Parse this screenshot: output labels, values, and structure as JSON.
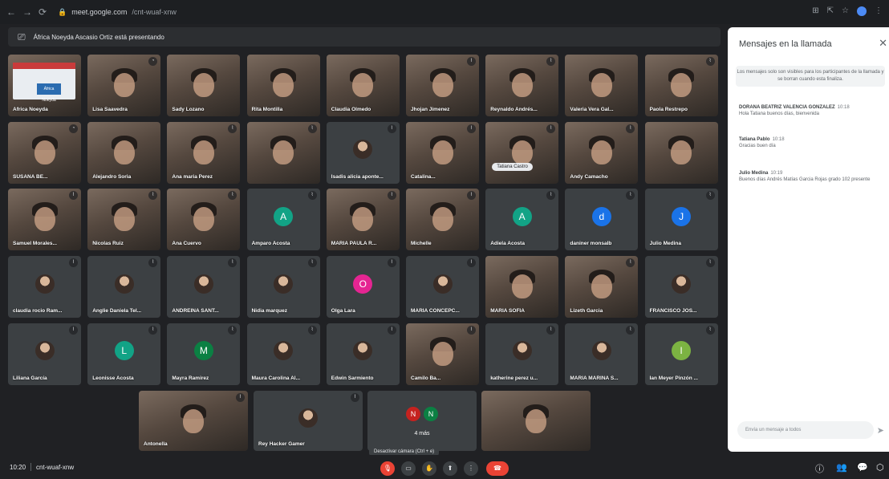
{
  "browser": {
    "url_host": "meet.google.com",
    "url_path": "/cnt-wuaf-xnw"
  },
  "presenting_banner": "África Noeyda Ascasio Ortiz está presentando",
  "tiles": [
    {
      "name": "Africa Noeyda",
      "type": "slide",
      "row": 0,
      "col": 0,
      "mic": "",
      "slide_text": "África Noeyda"
    },
    {
      "name": "Lisa Saavedra",
      "type": "video",
      "row": 0,
      "col": 1,
      "mic": "◔"
    },
    {
      "name": "Sady Lozano",
      "type": "video",
      "row": 0,
      "col": 2,
      "mic": ""
    },
    {
      "name": "Rita Montilla",
      "type": "video",
      "row": 0,
      "col": 3,
      "mic": ""
    },
    {
      "name": "Claudia Olmedo",
      "type": "video",
      "row": 0,
      "col": 4,
      "mic": ""
    },
    {
      "name": "Jhojan Jimenez",
      "type": "video",
      "row": 0,
      "col": 5,
      "mic": "⌇"
    },
    {
      "name": "Reynaldo Andrés...",
      "type": "video",
      "row": 0,
      "col": 6,
      "mic": "⌇"
    },
    {
      "name": "Valeria Vera Gal...",
      "type": "video",
      "row": 0,
      "col": 7,
      "mic": ""
    },
    {
      "name": "Paola Restrepo",
      "type": "video",
      "row": 0,
      "col": 8,
      "mic": "⌇"
    },
    {
      "name": "SUSANA BE...",
      "type": "video",
      "row": 1,
      "col": 0,
      "mic": "◔"
    },
    {
      "name": "Alejandro Soria",
      "type": "video",
      "row": 1,
      "col": 1,
      "mic": ""
    },
    {
      "name": "Ana maria Perez",
      "type": "video",
      "row": 1,
      "col": 2,
      "mic": "⌇"
    },
    {
      "name": "",
      "type": "video",
      "row": 1,
      "col": 3,
      "mic": "⌇"
    },
    {
      "name": "Isadis alicia aponte...",
      "type": "photo",
      "row": 1,
      "col": 4,
      "mic": "⌇"
    },
    {
      "name": "Catalina...",
      "type": "video",
      "row": 1,
      "col": 5,
      "mic": "⌇"
    },
    {
      "name": "",
      "type": "video",
      "row": 1,
      "col": 6,
      "mic": "⌇",
      "pill": "Tatiana Castro"
    },
    {
      "name": "Andy Camacho",
      "type": "video",
      "row": 1,
      "col": 7,
      "mic": "⌇"
    },
    {
      "name": "",
      "type": "video",
      "row": 1,
      "col": 8,
      "mic": ""
    },
    {
      "name": "Samuel Morales...",
      "type": "video",
      "row": 2,
      "col": 0,
      "mic": "⌇"
    },
    {
      "name": "Nicolas Ruiz",
      "type": "video",
      "row": 2,
      "col": 1,
      "mic": "⌇"
    },
    {
      "name": "Ana Cuervo",
      "type": "video",
      "row": 2,
      "col": 2,
      "mic": "⌇"
    },
    {
      "name": "Amparo Acosta",
      "type": "avatar",
      "row": 2,
      "col": 3,
      "mic": "⌇",
      "initial": "A",
      "color": "#12a386"
    },
    {
      "name": "MARIA PAULA R...",
      "type": "video",
      "row": 2,
      "col": 4,
      "mic": "⌇"
    },
    {
      "name": "Michelle",
      "type": "video",
      "row": 2,
      "col": 5,
      "mic": "⌇"
    },
    {
      "name": "Adiela Acosta",
      "type": "avatar",
      "row": 2,
      "col": 6,
      "mic": "⌇",
      "initial": "A",
      "color": "#12a386"
    },
    {
      "name": "daniner monsalb",
      "type": "avatar",
      "row": 2,
      "col": 7,
      "mic": "⌇",
      "initial": "d",
      "color": "#1a73e8"
    },
    {
      "name": "Julio Medina",
      "type": "avatar",
      "row": 2,
      "col": 8,
      "mic": "⌇",
      "initial": "J",
      "color": "#1a73e8"
    },
    {
      "name": "claudia rocio Ram...",
      "type": "photo",
      "row": 3,
      "col": 0,
      "mic": "⌇"
    },
    {
      "name": "Anglie Daniela Tel...",
      "type": "photo",
      "row": 3,
      "col": 1,
      "mic": "⌇"
    },
    {
      "name": "ANDREINA SANT...",
      "type": "photo",
      "row": 3,
      "col": 2,
      "mic": "⌇"
    },
    {
      "name": "Nidia marquez",
      "type": "photo",
      "row": 3,
      "col": 3,
      "mic": "⌇"
    },
    {
      "name": "Olga Lara",
      "type": "avatar",
      "row": 3,
      "col": 4,
      "mic": "⌇",
      "initial": "O",
      "color": "#e52592"
    },
    {
      "name": "MARIA CONCEPC...",
      "type": "photo",
      "row": 3,
      "col": 5,
      "mic": "⌇"
    },
    {
      "name": "MARIA SOFIA",
      "type": "video",
      "row": 3,
      "col": 6,
      "mic": ""
    },
    {
      "name": "Lizeth Garcia",
      "type": "video",
      "row": 3,
      "col": 7,
      "mic": "⌇"
    },
    {
      "name": "FRANCISCO JOS...",
      "type": "photo",
      "row": 3,
      "col": 8,
      "mic": "⌇"
    },
    {
      "name": "Liliana García",
      "type": "photo",
      "row": 4,
      "col": 0,
      "mic": "⌇"
    },
    {
      "name": "Leonisse Acosta",
      "type": "avatar",
      "row": 4,
      "col": 1,
      "mic": "⌇",
      "initial": "L",
      "color": "#12a386"
    },
    {
      "name": "Mayra Ramirez",
      "type": "avatar",
      "row": 4,
      "col": 2,
      "mic": "⌇",
      "initial": "M",
      "color": "#0b8043"
    },
    {
      "name": "Maura Carolina Al...",
      "type": "photo",
      "row": 4,
      "col": 3,
      "mic": "⌇"
    },
    {
      "name": "Edwin Sarmiento",
      "type": "photo",
      "row": 4,
      "col": 4,
      "mic": "⌇"
    },
    {
      "name": "Camilo Ba...",
      "type": "video",
      "row": 4,
      "col": 5,
      "mic": "⌇"
    },
    {
      "name": "katherine perez u...",
      "type": "photo",
      "row": 4,
      "col": 6,
      "mic": "⌇"
    },
    {
      "name": "MARIA MARINA S...",
      "type": "photo",
      "row": 4,
      "col": 7,
      "mic": "⌇"
    },
    {
      "name": "Ian Meyer Pinzón ...",
      "type": "avatar",
      "row": 4,
      "col": 8,
      "mic": "⌇",
      "initial": "I",
      "color": "#7cb342"
    }
  ],
  "bottom_tiles": [
    {
      "name": "Antonella",
      "type": "video",
      "mic": "⌇"
    },
    {
      "name": "Rey Hacker Gamer",
      "type": "photo",
      "mic": "⌇"
    },
    {
      "name": "4 más",
      "type": "more",
      "mic": "",
      "initials": [
        "N",
        "N"
      ],
      "colors": [
        "#c5221f",
        "#0b8043"
      ]
    },
    {
      "name": "",
      "type": "video",
      "mic": ""
    }
  ],
  "tooltip": "Desactivar cámara (Ctrl + e)",
  "chat": {
    "title": "Mensajes en la llamada",
    "notice": "Los mensajes solo son visibles para los participantes de la llamada y se borran cuando esta finaliza.",
    "messages": [
      {
        "sender": "DORANA BEATRIZ VALENCIA GONZALEZ",
        "time": "10:18",
        "text": "Hola Tatiana buenos días, bienvenida"
      },
      {
        "sender": "Tatiana Pablo",
        "time": "10:18",
        "text": "Gracias buen día"
      },
      {
        "sender": "Julio Medina",
        "time": "10:19",
        "text": "Buenos días Andrés Matías Garcia Rojas grado 102 presente"
      }
    ],
    "input_placeholder": "Envía un mensaje a todos"
  },
  "meeting": {
    "time": "10:20",
    "code": "cnt-wuaf-xnw"
  }
}
